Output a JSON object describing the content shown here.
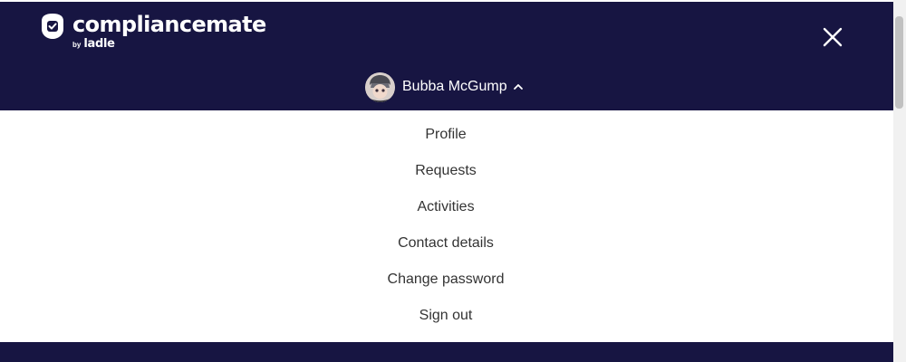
{
  "brand": {
    "name": "compliancemate",
    "by": "by",
    "parent": "ladle"
  },
  "header": {
    "close_icon": "close-icon"
  },
  "user": {
    "name": "Bubba McGump",
    "chevron_icon": "chevron-up-icon"
  },
  "menu": {
    "items": [
      {
        "label": "Profile"
      },
      {
        "label": "Requests"
      },
      {
        "label": "Activities"
      },
      {
        "label": "Contact details"
      },
      {
        "label": "Change password"
      },
      {
        "label": "Sign out"
      }
    ]
  },
  "colors": {
    "header_bg": "#171542",
    "menu_text": "#333333",
    "white": "#ffffff"
  }
}
